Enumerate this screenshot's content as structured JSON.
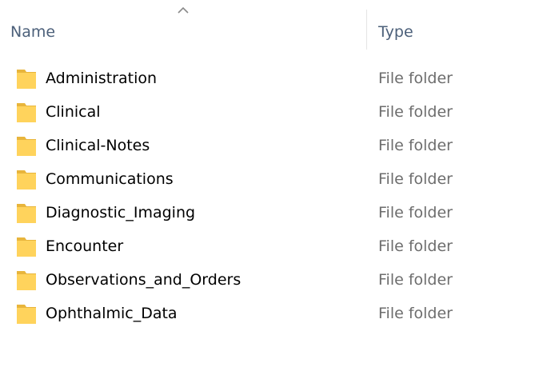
{
  "header": {
    "name_label": "Name",
    "type_label": "Type",
    "sort_direction": "ascending",
    "sort_icon": "chevron-up-icon"
  },
  "items": [
    {
      "name": "Administration",
      "type": "File folder",
      "icon": "folder-icon"
    },
    {
      "name": "Clinical",
      "type": "File folder",
      "icon": "folder-icon"
    },
    {
      "name": "Clinical-Notes",
      "type": "File folder",
      "icon": "folder-icon"
    },
    {
      "name": "Communications",
      "type": "File folder",
      "icon": "folder-icon"
    },
    {
      "name": "Diagnostic_Imaging",
      "type": "File folder",
      "icon": "folder-icon"
    },
    {
      "name": "Encounter",
      "type": "File folder",
      "icon": "folder-icon"
    },
    {
      "name": "Observations_and_Orders",
      "type": "File folder",
      "icon": "folder-icon"
    },
    {
      "name": "Ophthalmic_Data",
      "type": "File folder",
      "icon": "folder-icon"
    }
  ],
  "colors": {
    "header_text": "#4c607a",
    "item_text": "#000000",
    "type_text": "#6d6d6d",
    "folder_fill": "#ffd35c",
    "folder_edge": "#e8b53c",
    "divider": "#e5e5e5",
    "sort_arrow": "#8a8a8a"
  }
}
